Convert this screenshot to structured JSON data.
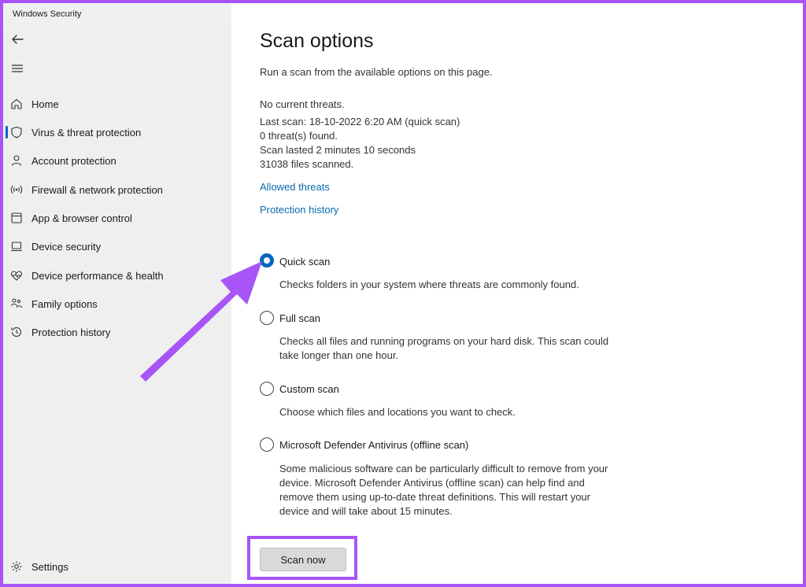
{
  "window": {
    "title": "Windows Security"
  },
  "sidebar": {
    "items": [
      {
        "label": "Home",
        "icon": "home-icon"
      },
      {
        "label": "Virus & threat protection",
        "icon": "shield-icon",
        "active": true
      },
      {
        "label": "Account protection",
        "icon": "person-icon"
      },
      {
        "label": "Firewall & network protection",
        "icon": "wifi-icon"
      },
      {
        "label": "App & browser control",
        "icon": "app-window-icon"
      },
      {
        "label": "Device security",
        "icon": "laptop-icon"
      },
      {
        "label": "Device performance & health",
        "icon": "heart-pulse-icon"
      },
      {
        "label": "Family options",
        "icon": "family-icon"
      },
      {
        "label": "Protection history",
        "icon": "history-icon"
      }
    ],
    "settings_label": "Settings"
  },
  "main": {
    "title": "Scan options",
    "subtitle": "Run a scan from the available options on this page.",
    "status": {
      "threats": "No current threats.",
      "last_scan": "Last scan: 18-10-2022 6:20 AM (quick scan)",
      "found": "0 threat(s) found.",
      "duration": "Scan lasted 2 minutes 10 seconds",
      "files": "31038 files scanned."
    },
    "links": {
      "allowed": "Allowed threats",
      "history": "Protection history"
    },
    "options": [
      {
        "label": "Quick scan",
        "selected": true,
        "desc": "Checks folders in your system where threats are commonly found."
      },
      {
        "label": "Full scan",
        "selected": false,
        "desc": "Checks all files and running programs on your hard disk. This scan could take longer than one hour."
      },
      {
        "label": "Custom scan",
        "selected": false,
        "desc": "Choose which files and locations you want to check."
      },
      {
        "label": "Microsoft Defender Antivirus (offline scan)",
        "selected": false,
        "desc": "Some malicious software can be particularly difficult to remove from your device. Microsoft Defender Antivirus (offline scan) can help find and remove them using up-to-date threat definitions. This will restart your device and will take about 15 minutes."
      }
    ],
    "scan_button": "Scan now"
  },
  "colors": {
    "accent": "#0067c0",
    "link": "#0a6bb0",
    "annotation": "#a855f7",
    "sidebar_bg": "#efefef"
  }
}
